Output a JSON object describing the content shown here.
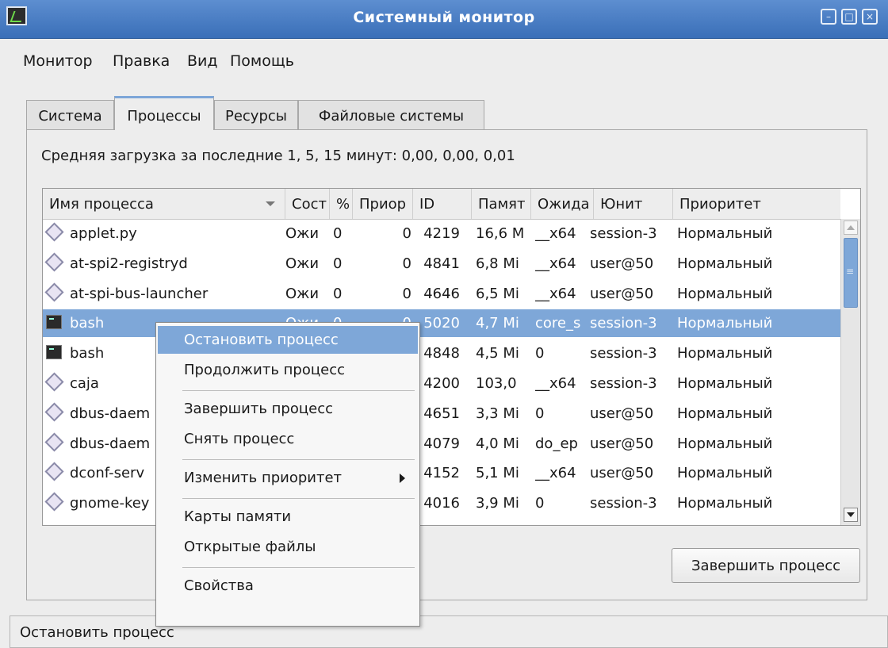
{
  "window": {
    "title": "Системный монитор"
  },
  "menubar": [
    "Монитор",
    "Правка",
    "Вид",
    "Помощь"
  ],
  "tabs": [
    "Система",
    "Процессы",
    "Ресурсы",
    "Файловые системы"
  ],
  "active_tab": "Процессы",
  "load_average": "Средняя загрузка за последние 1, 5, 15 минут: 0,00, 0,00, 0,01",
  "table": {
    "columns": [
      "Имя процесса",
      "Сост",
      "%",
      "Приор",
      "ID",
      "Памят",
      "Ожида",
      "Юнит",
      "Приоритет"
    ],
    "sorted_by": "Имя процесса",
    "rows": [
      {
        "name": "applet.py",
        "icon": "diamond",
        "state": "Ожи",
        "cpu": "0",
        "nice": "0",
        "id": "4219",
        "mem": "16,6 M",
        "wait": "__x64",
        "unit": "session-3",
        "prio": "Нормальный",
        "selected": false
      },
      {
        "name": "at-spi2-registryd",
        "icon": "diamond",
        "state": "Ожи",
        "cpu": "0",
        "nice": "0",
        "id": "4841",
        "mem": "6,8 Mi",
        "wait": "__x64",
        "unit": "user@50",
        "prio": "Нормальный",
        "selected": false
      },
      {
        "name": "at-spi-bus-launcher",
        "icon": "diamond",
        "state": "Ожи",
        "cpu": "0",
        "nice": "0",
        "id": "4646",
        "mem": "6,5 Mi",
        "wait": "__x64",
        "unit": "user@50",
        "prio": "Нормальный",
        "selected": false
      },
      {
        "name": "bash",
        "icon": "terminal",
        "state": "Ожи",
        "cpu": "0",
        "nice": "0",
        "id": "5020",
        "mem": "4,7 Mi",
        "wait": "core_s",
        "unit": "session-3",
        "prio": "Нормальный",
        "selected": true
      },
      {
        "name": "bash",
        "icon": "terminal",
        "state": "",
        "cpu": "",
        "nice": "",
        "id": "4848",
        "mem": "4,5 Mi",
        "wait": "0",
        "unit": "session-3",
        "prio": "Нормальный",
        "selected": false
      },
      {
        "name": "caja",
        "icon": "diamond",
        "state": "",
        "cpu": "",
        "nice": "",
        "id": "4200",
        "mem": "103,0",
        "wait": "__x64",
        "unit": "session-3",
        "prio": "Нормальный",
        "selected": false
      },
      {
        "name": "dbus-daem",
        "icon": "diamond",
        "state": "",
        "cpu": "",
        "nice": "",
        "id": "4651",
        "mem": "3,3 Mi",
        "wait": "0",
        "unit": "user@50",
        "prio": "Нормальный",
        "selected": false
      },
      {
        "name": "dbus-daem",
        "icon": "diamond",
        "state": "",
        "cpu": "",
        "nice": "",
        "id": "4079",
        "mem": "4,0 Mi",
        "wait": "do_ep",
        "unit": "user@50",
        "prio": "Нормальный",
        "selected": false
      },
      {
        "name": "dconf-serv",
        "icon": "diamond",
        "state": "",
        "cpu": "",
        "nice": "",
        "id": "4152",
        "mem": "5,1 Mi",
        "wait": "__x64",
        "unit": "user@50",
        "prio": "Нормальный",
        "selected": false
      },
      {
        "name": "gnome-key",
        "icon": "diamond",
        "state": "",
        "cpu": "",
        "nice": "",
        "id": "4016",
        "mem": "3,9 Mi",
        "wait": "0",
        "unit": "session-3",
        "prio": "Нормальный",
        "selected": false
      }
    ]
  },
  "end_process_button": "Завершить процесс",
  "context_menu": {
    "items": [
      {
        "label": "Остановить процесс",
        "highlighted": true
      },
      {
        "label": "Продолжить процесс"
      },
      {
        "separator": true
      },
      {
        "label": "Завершить процесс"
      },
      {
        "label": "Снять процесс"
      },
      {
        "separator": true
      },
      {
        "label": "Изменить приоритет",
        "submenu": true
      },
      {
        "separator": true
      },
      {
        "label": "Карты памяти"
      },
      {
        "label": "Открытые файлы"
      },
      {
        "separator": true
      },
      {
        "label": "Свойства"
      }
    ]
  },
  "statusbar": "Остановить процесс",
  "colors": {
    "titlebar": "#4a7fc4",
    "selection": "#7ea7d8"
  }
}
